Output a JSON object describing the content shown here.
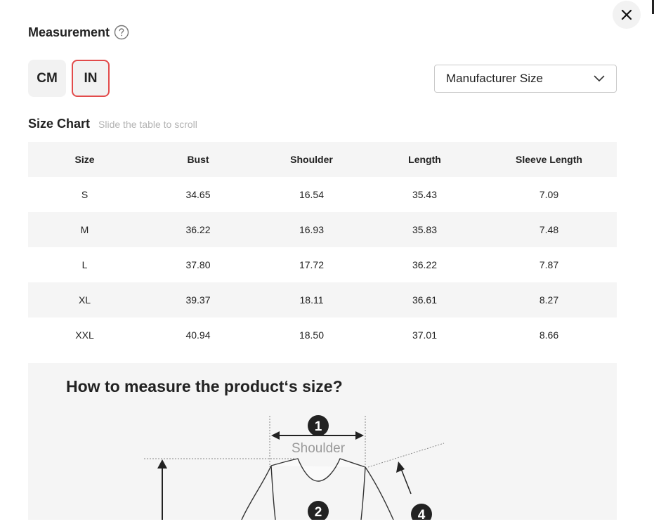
{
  "header": {
    "title": "Measurement",
    "close_label": "close"
  },
  "units": {
    "options": [
      "CM",
      "IN"
    ],
    "selected": "IN"
  },
  "size_type_select": {
    "value": "Manufacturer Size"
  },
  "size_chart": {
    "title": "Size Chart",
    "hint": "Slide the table to scroll",
    "columns": [
      "Size",
      "Bust",
      "Shoulder",
      "Length",
      "Sleeve Length"
    ],
    "rows": [
      [
        "S",
        "34.65",
        "16.54",
        "35.43",
        "7.09"
      ],
      [
        "M",
        "36.22",
        "16.93",
        "35.83",
        "7.48"
      ],
      [
        "L",
        "37.80",
        "17.72",
        "36.22",
        "7.87"
      ],
      [
        "XL",
        "39.37",
        "18.11",
        "36.61",
        "8.27"
      ],
      [
        "XXL",
        "40.94",
        "18.50",
        "37.01",
        "8.66"
      ]
    ]
  },
  "measure_guide": {
    "title": "How to measure the product‘s size?",
    "markers": [
      "1",
      "2",
      "4"
    ],
    "shoulder_label": "Shoulder"
  },
  "colors": {
    "accent_border": "#e24b4b",
    "stripe": "#f5f5f5",
    "muted_text": "#b3b3b3"
  },
  "icons": [
    "close-icon",
    "help-circle-icon",
    "chevron-down-icon"
  ]
}
